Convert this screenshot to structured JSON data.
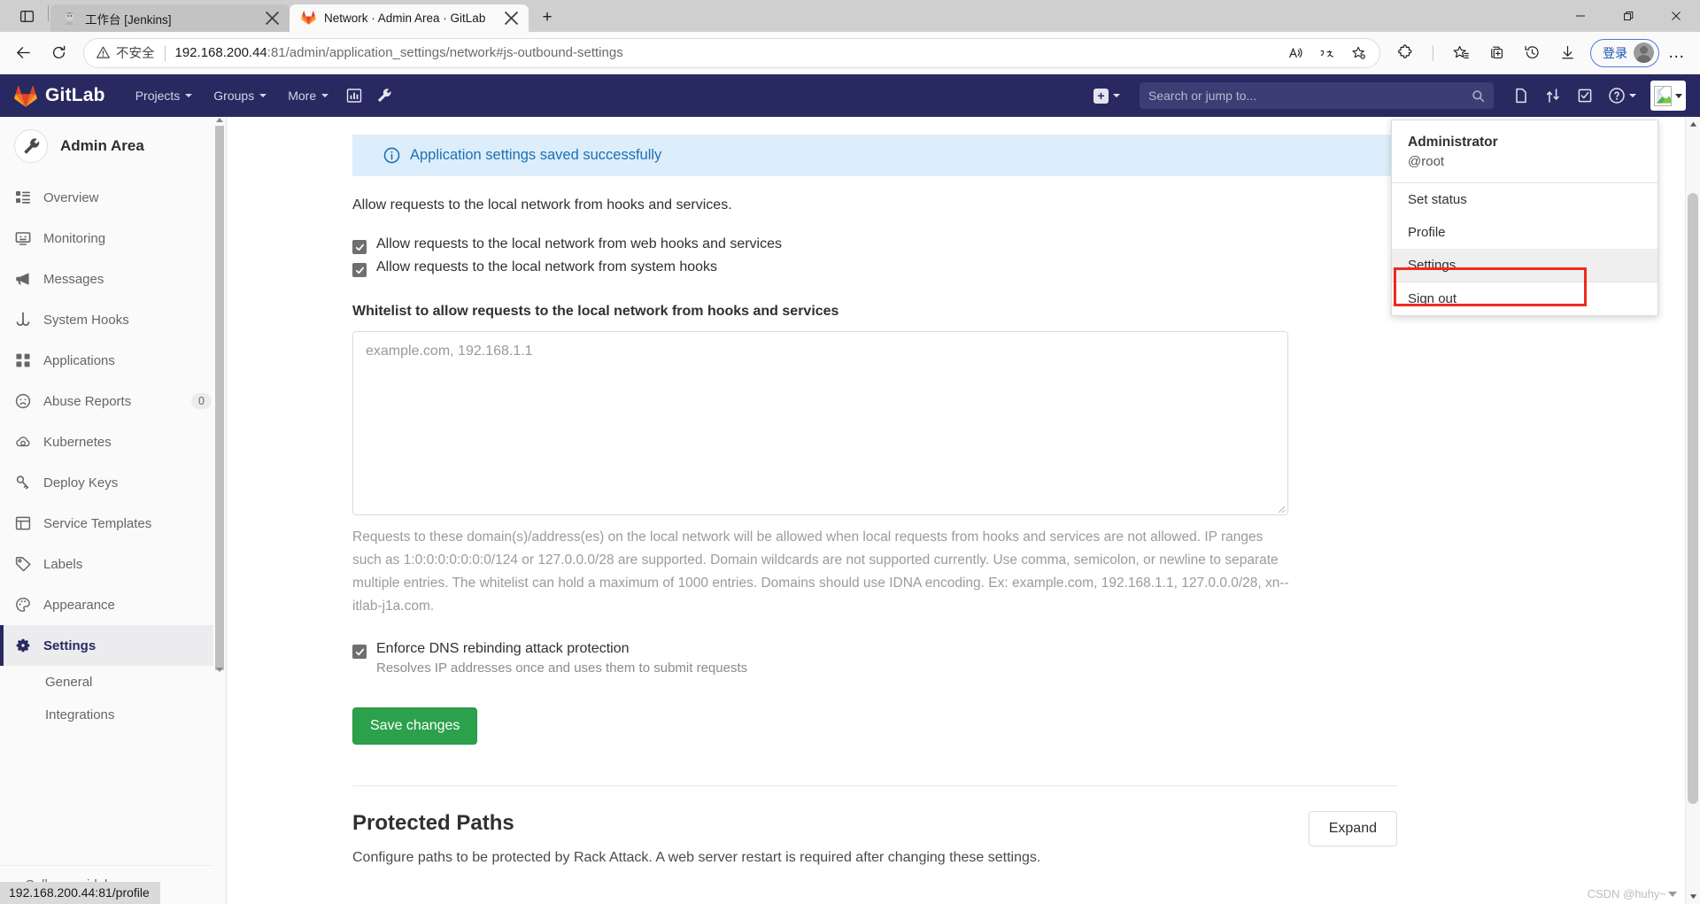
{
  "window": {
    "tabs": [
      {
        "title": "工作台 [Jenkins]",
        "favicon": "jenkins-icon",
        "active": false
      },
      {
        "title": "Network · Admin Area · GitLab",
        "favicon": "gitlab-icon",
        "active": true
      }
    ],
    "new_tab_label": "+",
    "controls": {
      "minimize": "minimize-icon",
      "maximize": "maximize-icon",
      "close": "close-icon"
    },
    "tab_list_icon": "tab-list-icon"
  },
  "browser": {
    "back": "back-arrow-icon",
    "reload": "reload-icon",
    "security_label": "不安全",
    "security_icon": "warning-triangle-icon",
    "url_host": "192.168.200.44",
    "url_rest": ":81/admin/application_settings/network#js-outbound-settings",
    "omnibox_actions": [
      "read-aloud-icon",
      "translate-icon",
      "add-favorite-icon"
    ],
    "toolbar_actions": [
      "extensions-icon",
      "favorites-icon",
      "collections-icon",
      "history-icon",
      "downloads-icon"
    ],
    "signin_label": "登录",
    "more_label": "…",
    "status_url": "192.168.200.44:81/profile"
  },
  "gitlab_nav": {
    "brand": "GitLab",
    "items": [
      {
        "label": "Projects",
        "caret": true
      },
      {
        "label": "Groups",
        "caret": true
      },
      {
        "label": "More",
        "caret": true
      }
    ],
    "icon_buttons": [
      "analytics-icon",
      "wrench-icon"
    ],
    "create_new_label": "+",
    "search_placeholder": "Search or jump to...",
    "search_icon": "search-icon",
    "right_icons": [
      "issues-icon",
      "merge-requests-icon",
      "todos-icon",
      "help-icon"
    ],
    "avatar": "broken-image-avatar-icon"
  },
  "user_menu": {
    "name": "Administrator",
    "handle": "@root",
    "items": [
      {
        "label": "Set status",
        "highlighted": false
      },
      {
        "label": "Profile",
        "highlighted": false
      },
      {
        "label": "Settings",
        "highlighted": true
      },
      {
        "label": "Sign out",
        "highlighted": false
      }
    ]
  },
  "sidebar": {
    "title": "Admin Area",
    "avatar_icon": "wrench-icon",
    "items": [
      {
        "label": "Overview",
        "icon": "overview-icon",
        "badge": null,
        "active": false
      },
      {
        "label": "Monitoring",
        "icon": "monitor-icon",
        "badge": null,
        "active": false
      },
      {
        "label": "Messages",
        "icon": "megaphone-icon",
        "badge": null,
        "active": false
      },
      {
        "label": "System Hooks",
        "icon": "hook-icon",
        "badge": null,
        "active": false
      },
      {
        "label": "Applications",
        "icon": "applications-icon",
        "badge": null,
        "active": false
      },
      {
        "label": "Abuse Reports",
        "icon": "abuse-icon",
        "badge": "0",
        "active": false
      },
      {
        "label": "Kubernetes",
        "icon": "kubernetes-icon",
        "badge": null,
        "active": false
      },
      {
        "label": "Deploy Keys",
        "icon": "key-icon",
        "badge": null,
        "active": false
      },
      {
        "label": "Service Templates",
        "icon": "template-icon",
        "badge": null,
        "active": false
      },
      {
        "label": "Labels",
        "icon": "label-icon",
        "badge": null,
        "active": false
      },
      {
        "label": "Appearance",
        "icon": "palette-icon",
        "badge": null,
        "active": false
      },
      {
        "label": "Settings",
        "icon": "gear-icon",
        "badge": null,
        "active": true
      }
    ],
    "sub_items": [
      {
        "label": "General"
      },
      {
        "label": "Integrations"
      }
    ],
    "collapse_label": "Collapse sidebar",
    "collapse_icon": "chevron-double-left-icon"
  },
  "main": {
    "alert": {
      "icon": "info-circle-icon",
      "text": "Application settings saved successfully"
    },
    "section_description": "Allow requests to the local network from hooks and services.",
    "checkboxes": [
      {
        "label": "Allow requests to the local network from web hooks and services",
        "checked": true
      },
      {
        "label": "Allow requests to the local network from system hooks",
        "checked": true
      }
    ],
    "whitelist_label": "Whitelist to allow requests to the local network from hooks and services",
    "whitelist_placeholder": "example.com, 192.168.1.1",
    "whitelist_value": "",
    "whitelist_help": "Requests to these domain(s)/address(es) on the local network will be allowed when local requests from hooks and services are not allowed. IP ranges such as 1:0:0:0:0:0:0:0/124 or 127.0.0.0/28 are supported. Domain wildcards are not supported currently. Use comma, semicolon, or newline to separate multiple entries. The whitelist can hold a maximum of 1000 entries. Domains should use IDNA encoding. Ex: example.com, 192.168.1.1, 127.0.0.0/28, xn--itlab-j1a.com.",
    "dns_checkbox": {
      "label": "Enforce DNS rebinding attack protection",
      "checked": true
    },
    "dns_sub": "Resolves IP addresses once and uses them to submit requests",
    "save_label": "Save changes",
    "protected_paths": {
      "title": "Protected Paths",
      "description": "Configure paths to be protected by Rack Attack. A web server restart is required after changing these settings.",
      "expand_label": "Expand"
    },
    "watermark": "CSDN @huhy~"
  },
  "colors": {
    "gitlab_navy": "#292961",
    "alert_bg": "#dceefb",
    "alert_text": "#1f6fb2",
    "save_green": "#2ca14b",
    "highlight_red": "#f0291f",
    "signin_blue": "#1552b5"
  }
}
